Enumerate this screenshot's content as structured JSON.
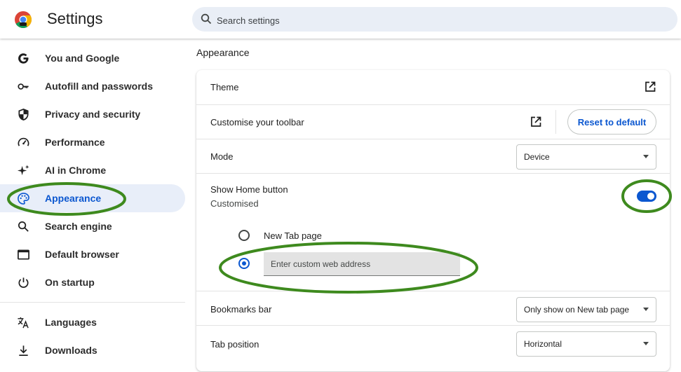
{
  "app": {
    "title": "Settings"
  },
  "search": {
    "placeholder": "Search settings"
  },
  "sidebar": {
    "items": [
      {
        "label": "You and Google",
        "icon": "google-g-icon"
      },
      {
        "label": "Autofill and passwords",
        "icon": "key-icon"
      },
      {
        "label": "Privacy and security",
        "icon": "shield-icon"
      },
      {
        "label": "Performance",
        "icon": "speedometer-icon"
      },
      {
        "label": "AI in Chrome",
        "icon": "sparkle-icon"
      },
      {
        "label": "Appearance",
        "icon": "palette-icon",
        "active": true
      },
      {
        "label": "Search engine",
        "icon": "search-icon"
      },
      {
        "label": "Default browser",
        "icon": "browser-window-icon"
      },
      {
        "label": "On startup",
        "icon": "power-icon"
      },
      {
        "label": "Languages",
        "icon": "translate-icon"
      },
      {
        "label": "Downloads",
        "icon": "download-icon"
      }
    ]
  },
  "main": {
    "section_title": "Appearance",
    "theme": {
      "label": "Theme",
      "icon": "external-link-icon"
    },
    "toolbar": {
      "label": "Customise your toolbar",
      "icon": "external-link-icon",
      "reset_label": "Reset to default"
    },
    "mode": {
      "label": "Mode",
      "value": "Device"
    },
    "home_button": {
      "label": "Show Home button",
      "sublabel": "Customised",
      "toggle_on": true,
      "options": [
        {
          "label": "New Tab page",
          "selected": false
        },
        {
          "placeholder": "Enter custom web address",
          "selected": true
        }
      ]
    },
    "bookmarks_bar": {
      "label": "Bookmarks bar",
      "value": "Only show on New tab page"
    },
    "tab_position": {
      "label": "Tab position",
      "value": "Horizontal"
    }
  },
  "colors": {
    "accent": "#0b57d0",
    "active_nav_bg": "#e8eef9",
    "annotation_green": "#3e8a1e"
  }
}
